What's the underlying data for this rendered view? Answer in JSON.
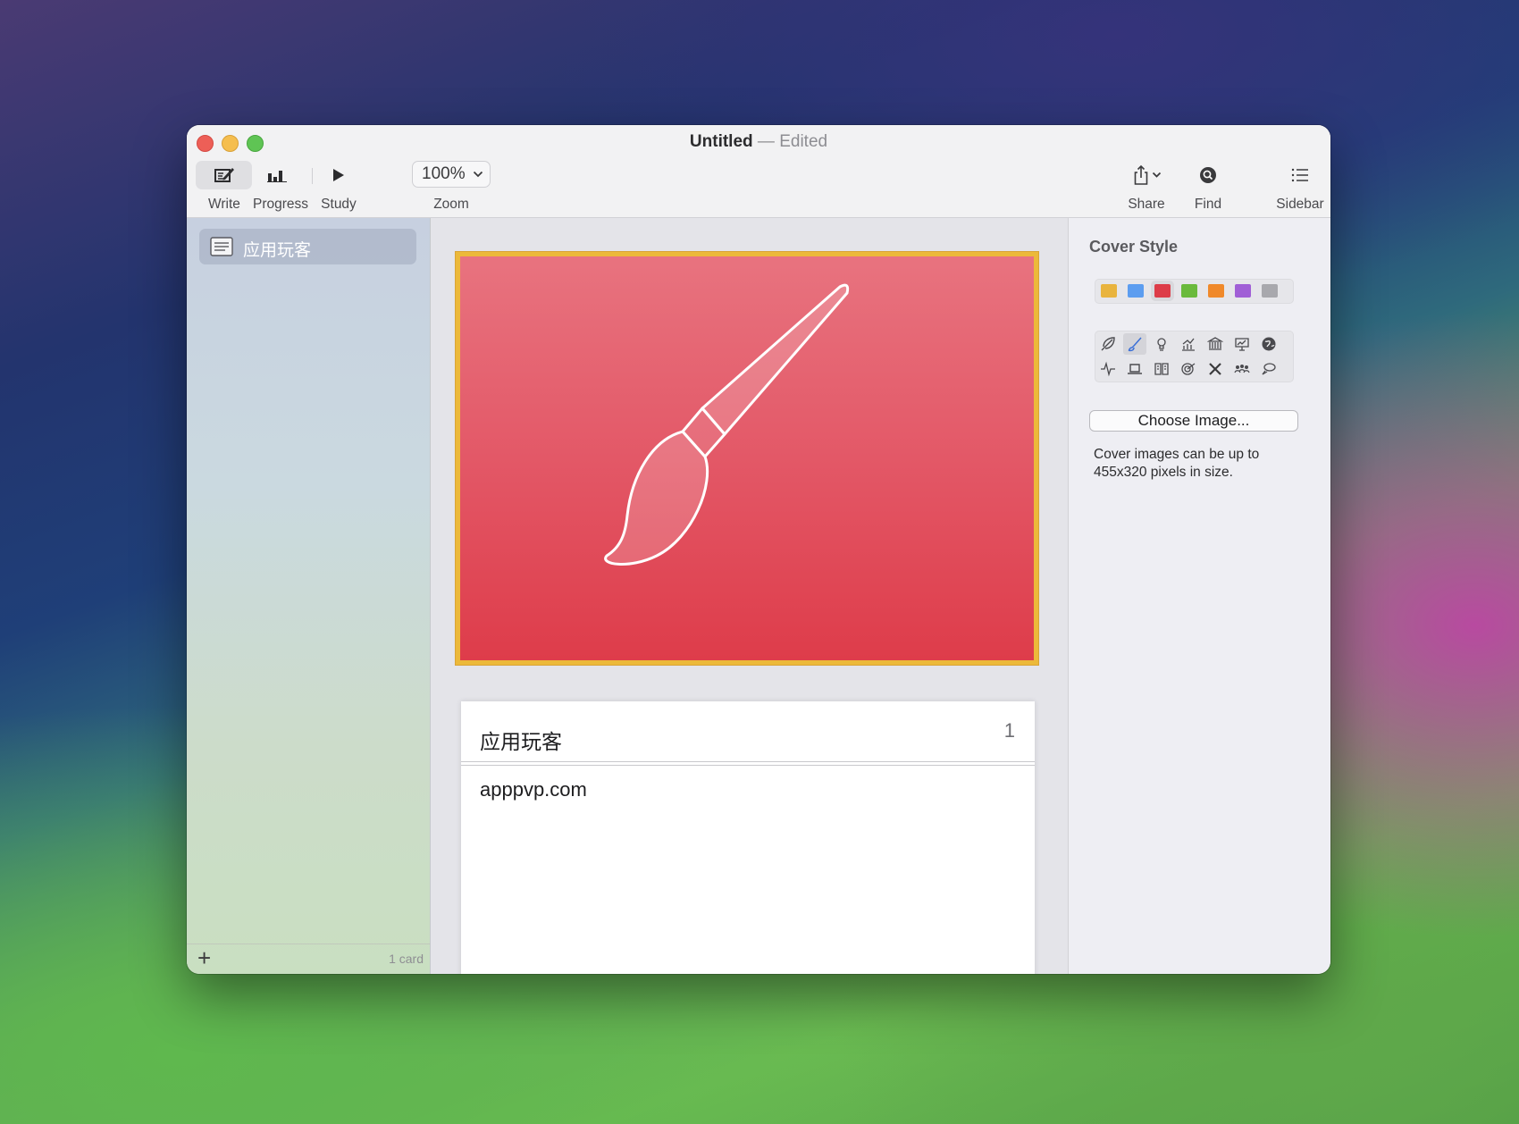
{
  "window": {
    "title": "Untitled",
    "title_separator": "—",
    "title_status": "Edited"
  },
  "toolbar": {
    "write_label": "Write",
    "progress_label": "Progress",
    "study_label": "Study",
    "zoom_value": "100%",
    "zoom_label": "Zoom",
    "share_label": "Share",
    "find_label": "Find",
    "sidebar_label": "Sidebar"
  },
  "sidebar": {
    "items": [
      {
        "label": "应用玩客",
        "icon": "card-stack-icon"
      }
    ],
    "add_icon": "+",
    "count": "1 card"
  },
  "cover": {
    "icon": "paintbrush-icon",
    "colors": {
      "top": "#e8737f",
      "bottom": "#de3c4a",
      "border": "#ecb93a"
    }
  },
  "card": {
    "title": "应用玩客",
    "number": "1",
    "body": "apppvp.com"
  },
  "inspector": {
    "title": "Cover Style",
    "colors": [
      "#e9b43e",
      "#5c9df0",
      "#dd3c48",
      "#6aba3c",
      "#f0892a",
      "#a05fd6",
      "#a8a8ad"
    ],
    "selected_color_index": 2,
    "icons": [
      "feather-icon",
      "paintbrush-icon",
      "lightbulb-icon",
      "bar-chart-icon",
      "bank-icon",
      "presentation-icon",
      "globe-icon",
      "pulse-icon",
      "laptop-icon",
      "book-icon",
      "target-icon",
      "tools-icon",
      "people-icon",
      "speech-bubbles-icon"
    ],
    "selected_icon_index": 1,
    "choose_button": "Choose Image...",
    "note": "Cover images can be up to 455x320 pixels in size."
  }
}
